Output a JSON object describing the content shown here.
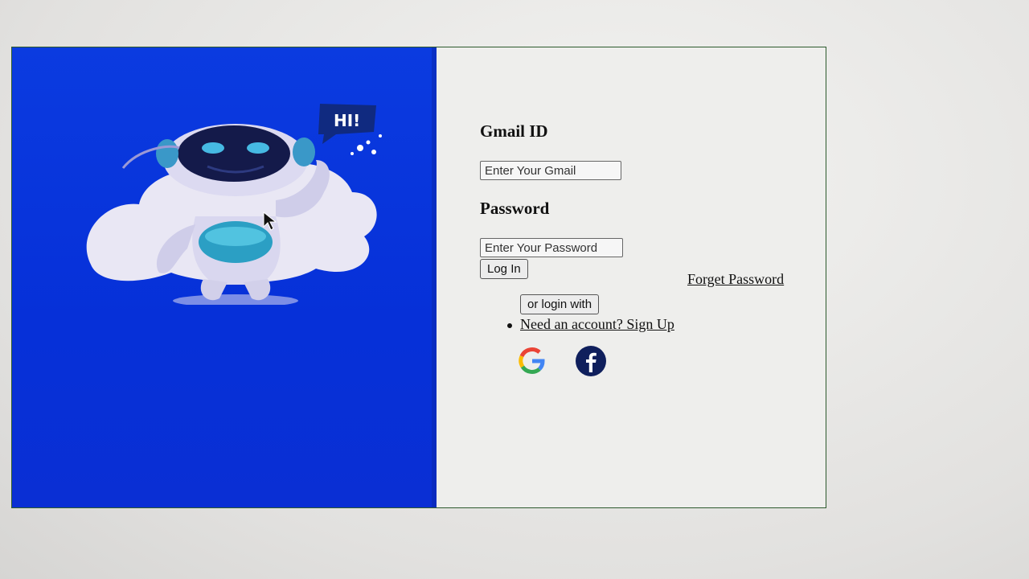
{
  "robot": {
    "greeting": "HI!"
  },
  "form": {
    "gmail_label": "Gmail ID",
    "gmail_placeholder": "Enter Your Gmail",
    "password_label": "Password",
    "password_placeholder": "Enter Your Password",
    "login_label": "Log In",
    "forget_label": "Forget Password",
    "or_login_label": "or login with",
    "signup_label": "Need an account? Sign Up"
  },
  "social": {
    "google_icon": "google-icon",
    "facebook_icon": "facebook-icon"
  },
  "colors": {
    "left_bg": "#0a35dc",
    "right_bg": "#eeeeec",
    "frame_border": "#2d5a2d"
  }
}
